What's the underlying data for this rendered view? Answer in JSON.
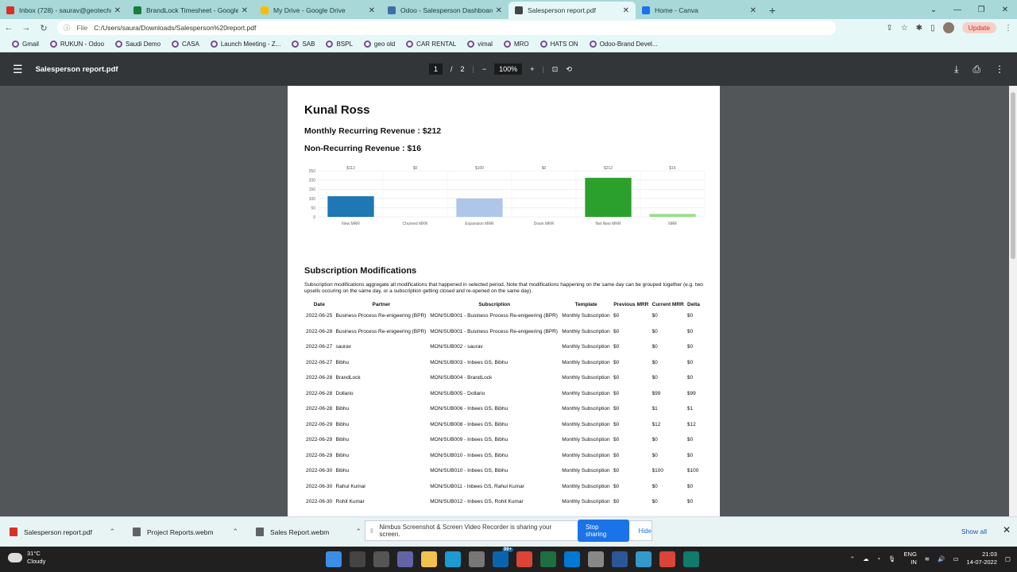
{
  "tabs": [
    {
      "title": "Inbox (728) - saurav@geotechno",
      "icon": "gmail-icon",
      "color": "#d93025"
    },
    {
      "title": "BrandLock Timesheet - Google Sh",
      "icon": "sheets-icon",
      "color": "#188038"
    },
    {
      "title": "My Drive - Google Drive",
      "icon": "drive-icon",
      "color": "#fbbc04"
    },
    {
      "title": "Odoo - Salesperson Dashboard",
      "icon": "odoo-icon",
      "color": "#3d6fa8"
    },
    {
      "title": "Salesperson report.pdf",
      "icon": "globe-icon",
      "color": "#444"
    },
    {
      "title": "Home - Canva",
      "icon": "canva-icon",
      "color": "#1a73e8"
    }
  ],
  "address": {
    "scheme": "File",
    "url": "C:/Users/saura/Downloads/Salesperson%20report.pdf",
    "update": "Update"
  },
  "bookmarks": [
    "Gmail",
    "RUKUN - Odoo",
    "Saudi Demo",
    "CASA",
    "Launch Meeting - Z...",
    "SAB",
    "BSPL",
    "geo old",
    "CAR RENTAL",
    "vimal",
    "MRO",
    "HATS ON",
    "Odoo-Brand Devel..."
  ],
  "pdf": {
    "filename": "Salesperson report.pdf",
    "page": "1",
    "sep": "/",
    "pages": "2",
    "zoom": "100%"
  },
  "report": {
    "name": "Kunal Ross",
    "mrr": "Monthly Recurring Revenue : $212",
    "nrr": "Non-Recurring Revenue : $16",
    "section": "Subscription Modifications",
    "desc": "Subscription modifications aggregate all modifications that happened in selected period. Note that modifications happening on the same day can be grouped together (e.g. two upsells occuring on the same day, or a subscription getting closed and re-opened on the same day).",
    "headers": [
      "Date",
      "Partner",
      "Subscription",
      "Template",
      "Previous MRR",
      "Current MRR",
      "Delta"
    ],
    "rows": [
      [
        "2022-06-25",
        "Business Process Re-enigeering (BPR)",
        "MON/SUB001 - Business Process Re-enigeering (BPR)",
        "Monthly Subscription",
        "$0",
        "$0",
        "$0"
      ],
      [
        "2022-06-28",
        "Business Process Re-enigeering (BPR)",
        "MON/SUB001 - Business Process Re-enigeering (BPR)",
        "Monthly Subscription",
        "$0",
        "$0",
        "$0"
      ],
      [
        "2022-06-27",
        "saurav",
        "MON/SUB002 - saurav",
        "Monthly Subscription",
        "$0",
        "$0",
        "$0"
      ],
      [
        "2022-06-27",
        "Bibhu",
        "MON/SUB003 - Inbees GS, Bibhu",
        "Monthly Subscription",
        "$0",
        "$0",
        "$0"
      ],
      [
        "2022-06-28",
        "BrandLock",
        "MON/SUB004 - BrandLock",
        "Monthly Subscription",
        "$0",
        "$0",
        "$0"
      ],
      [
        "2022-06-28",
        "Dollario",
        "MON/SUB005 - Dollario",
        "Monthly Subscription",
        "$0",
        "$99",
        "$99"
      ],
      [
        "2022-06-28",
        "Bibhu",
        "MON/SUB006 - Inbees GS, Bibhu",
        "Monthly Subscription",
        "$0",
        "$1",
        "$1"
      ],
      [
        "2022-06-29",
        "Bibhu",
        "MON/SUB008 - Inbees GS, Bibhu",
        "Monthly Subscription",
        "$0",
        "$12",
        "$12"
      ],
      [
        "2022-06-29",
        "Bibhu",
        "MON/SUB009 - Inbees GS, Bibhu",
        "Monthly Subscription",
        "$0",
        "$0",
        "$0"
      ],
      [
        "2022-06-29",
        "Bibhu",
        "MON/SUB010 - Inbees GS, Bibhu",
        "Monthly Subscription",
        "$0",
        "$0",
        "$0"
      ],
      [
        "2022-06-30",
        "Bibhu",
        "MON/SUB010 - Inbees GS, Bibhu",
        "Monthly Subscription",
        "$0",
        "$100",
        "$100"
      ],
      [
        "2022-06-30",
        "Rahul Kumar",
        "MON/SUB011 - Inbees GS, Rahul Kumar",
        "Monthly Subscription",
        "$0",
        "$0",
        "$0"
      ],
      [
        "2022-06-30",
        "Rohit Kumar",
        "MON/SUB012 - Inbees GS, Rohit Kumar",
        "Monthly Subscription",
        "$0",
        "$0",
        "$0"
      ]
    ]
  },
  "chart_data": {
    "type": "bar",
    "categories": [
      "New MRR",
      "Churned MRR",
      "Expansion MRR",
      "Down MRR",
      "Net New MRR",
      "NRR"
    ],
    "values": [
      112,
      0,
      100,
      0,
      212,
      16
    ],
    "data_labels": [
      "$112",
      "$0",
      "$100",
      "$0",
      "$212",
      "$16"
    ],
    "colors": [
      "#1f77b4",
      "#aec7e8",
      "#aec7e8",
      "#ff7f0e",
      "#2ca02c",
      "#98df8a"
    ],
    "yticks": [
      0,
      50,
      100,
      150,
      200,
      250
    ],
    "ylim": [
      0,
      250
    ],
    "grid": true
  },
  "downloads": [
    {
      "name": "Salesperson report.pdf",
      "color": "#d93025"
    },
    {
      "name": "Project Reports.webm",
      "color": "#5f6368"
    },
    {
      "name": "Sales Report.webm",
      "color": "#5f6368"
    }
  ],
  "share": {
    "text": "Nimbus Screenshot & Screen Video Recorder is sharing your screen.",
    "stop": "Stop sharing",
    "hide": "Hide"
  },
  "show_all": "Show all",
  "taskbar": {
    "temp": "31°C",
    "weather": "Cloudy",
    "lang1": "ENG",
    "lang2": "IN",
    "time": "21:03",
    "date": "14-07-2022",
    "badge": "99+"
  }
}
